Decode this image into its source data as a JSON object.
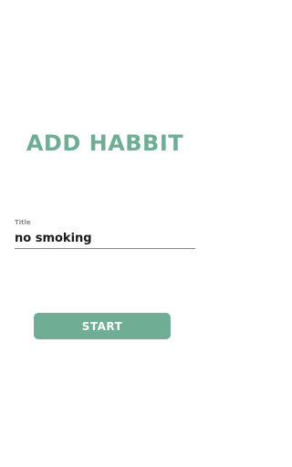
{
  "header": {
    "title": "ADD HABBIT"
  },
  "form": {
    "title_label": "Title",
    "title_value": "no smoking",
    "start_label": "START"
  },
  "colors": {
    "accent": "#6fae94",
    "label": "#8b8b8b",
    "text": "#1b1b1b",
    "background": "#ffffff"
  }
}
